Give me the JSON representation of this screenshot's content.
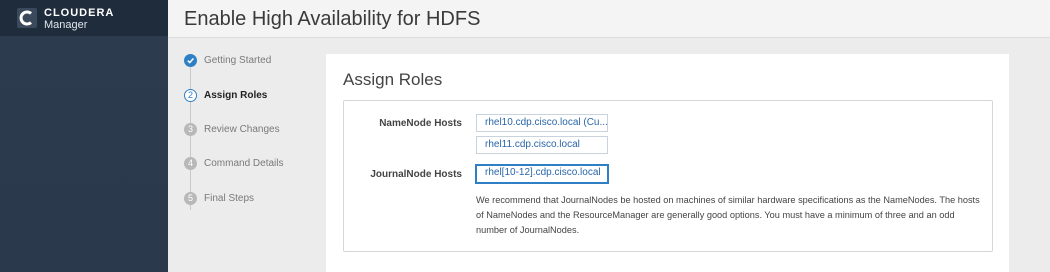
{
  "brand": {
    "name_top": "CLOUDERA",
    "name_bottom": "Manager"
  },
  "page": {
    "title": "Enable High Availability for HDFS"
  },
  "steps": [
    {
      "number": "",
      "label": "Getting Started",
      "state": "done"
    },
    {
      "number": "2",
      "label": "Assign Roles",
      "state": "current"
    },
    {
      "number": "3",
      "label": "Review Changes",
      "state": "pending"
    },
    {
      "number": "4",
      "label": "Command Details",
      "state": "pending"
    },
    {
      "number": "5",
      "label": "Final Steps",
      "state": "pending"
    }
  ],
  "assign_roles": {
    "title": "Assign Roles",
    "namenode": {
      "label": "NameNode Hosts",
      "hosts": [
        "rhel10.cdp.cisco.local (Cu...",
        "rhel11.cdp.cisco.local"
      ]
    },
    "journalnode": {
      "label": "JournalNode Hosts",
      "host": "rhel[10-12].cdp.cisco.local",
      "help": "We recommend that JournalNodes be hosted on machines of similar hardware specifications as the NameNodes. The hosts of NameNodes and the ResourceManager are generally good options. You must have a minimum of three and an odd number of JournalNodes."
    }
  },
  "colors": {
    "sidebar": "#2c3c4e",
    "accent": "#2f7fc5",
    "link": "#2a66a8"
  }
}
